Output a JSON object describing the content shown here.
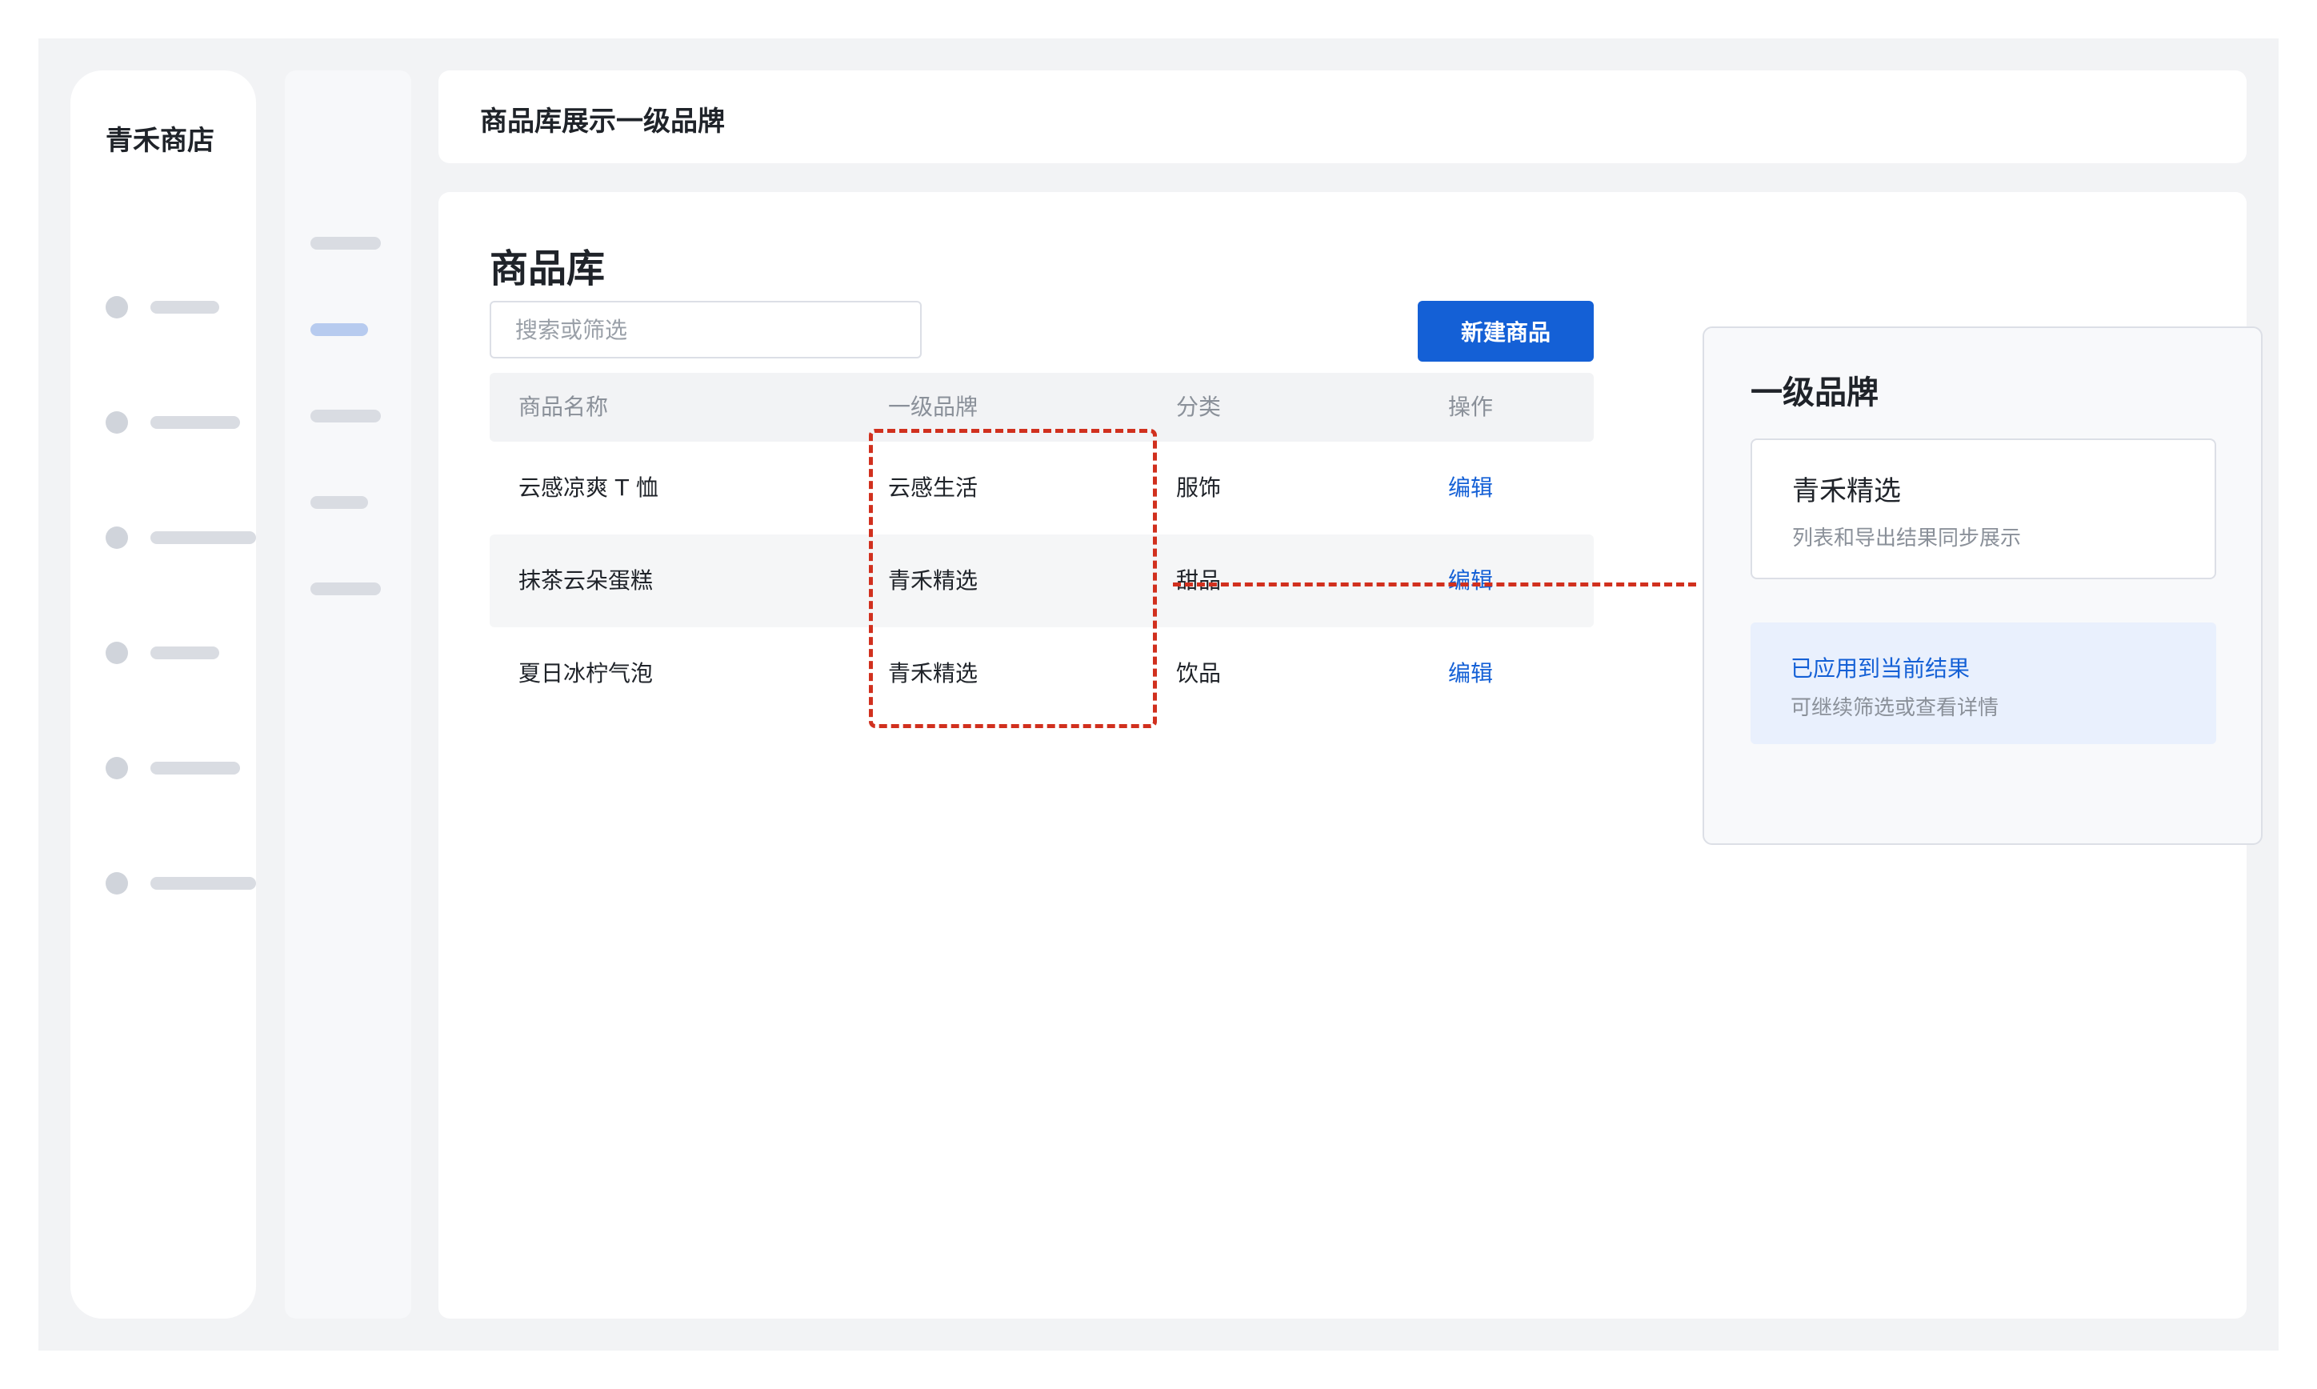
{
  "app": {
    "brand": "青禾商店"
  },
  "header": {
    "title": "商品库展示一级品牌"
  },
  "main": {
    "title": "商品库",
    "search_placeholder": "搜索或筛选",
    "new_button_label": "新建商品",
    "columns": [
      "商品名称",
      "一级品牌",
      "分类",
      "操作"
    ],
    "rows": [
      {
        "name": "云感凉爽 T 恤",
        "brand": "云感生活",
        "category": "服饰",
        "action": "编辑"
      },
      {
        "name": "抹茶云朵蛋糕",
        "brand": "青禾精选",
        "category": "甜品",
        "action": "编辑"
      },
      {
        "name": "夏日冰柠气泡",
        "brand": "青禾精选",
        "category": "饮品",
        "action": "编辑"
      }
    ]
  },
  "panel": {
    "title": "一级品牌",
    "option": {
      "name": "青禾精选",
      "description": "列表和导出结果同步展示"
    },
    "status": {
      "title": "已应用到当前结果",
      "subtitle": "可继续筛选或查看详情"
    }
  },
  "colors": {
    "accent": "#1460d6",
    "annotation": "#d1301e",
    "frame_background": "#f2f3f5",
    "status_background": "#e9f0fd"
  }
}
